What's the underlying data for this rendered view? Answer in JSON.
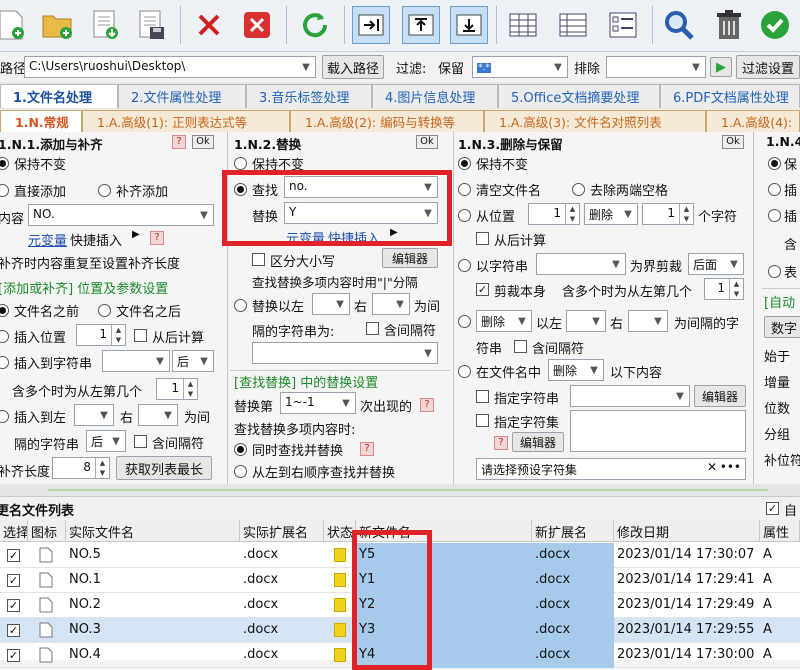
{
  "toolbar": {
    "icons": [
      "add-file-icon",
      "add-folder-icon",
      "import-list-icon",
      "export-list-icon",
      "delete-icon",
      "clear-icon",
      "refresh-icon",
      "move-right-icon",
      "move-up-icon",
      "move-down-icon",
      "columns-icon",
      "rows-icon",
      "checklist-icon",
      "search-icon",
      "trash-icon",
      "check-icon"
    ]
  },
  "pathbar": {
    "label": "路径",
    "path": "C:\\Users\\ruoshui\\Desktop\\",
    "load_button": "载入路径",
    "filter_label": "过滤:",
    "keep_label": "保留",
    "keep_value": "*.*",
    "exclude_label": "排除",
    "exclude_value": "",
    "filter_settings": "过滤设置"
  },
  "tabs1": [
    "1.文件名处理",
    "2.文件属性处理",
    "3.音乐标签处理",
    "4.图片信息处理",
    "5.Office文档摘要处理",
    "6.PDF文档属性处理"
  ],
  "tabs2": [
    "1.N.常规",
    "1.A.高级(1): 正则表达式等",
    "1.A.高级(2): 编码与转换等",
    "1.A.高级(3): 文件名对照列表",
    "1.A.高级(4):"
  ],
  "panel1": {
    "title": "1.N.1.添加与补齐",
    "help": "?",
    "ok": "Ok",
    "keep": "保持不变",
    "direct_add": "直接添加",
    "pad_add": "补齐添加",
    "content_label": "内容",
    "content_value": "NO.",
    "meta_var": "元变量",
    "quick_insert": "快捷插入",
    "hint": "补齐时内容重复至设置补齐长度",
    "section": "[添加或补齐] 位置及参数设置",
    "before_name": "文件名之前",
    "after_name": "文件名之后",
    "insert_pos": "插入位置",
    "insert_pos_value": "1",
    "from_back": "从后计算",
    "insert_to_str": "插入到字符串",
    "insert_dir": "后",
    "multi_which": "含多个时为从左第几个",
    "multi_which_value": "1",
    "insert_left": "插入到左",
    "right": "右",
    "between": "为间",
    "between_str": "隔的字符串",
    "between_dir": "后",
    "include_sep": "含间隔符",
    "pad_len": "补齐长度",
    "pad_len_value": "8",
    "get_max": "获取列表最长"
  },
  "panel2": {
    "title": "1.N.2.替换",
    "ok": "Ok",
    "keep": "保持不变",
    "find_label": "查找",
    "find_value": "no.",
    "replace_label": "替换",
    "replace_value": "Y",
    "meta_var": "元变量",
    "quick_insert": "快捷插入",
    "case": "区分大小写",
    "editor": "编辑器",
    "multi_hint": "查找替换多项内容时用\"|\"分隔",
    "replace_left": "替换以左",
    "right": "右",
    "between": "为间",
    "between_str": "隔的字符串为:",
    "include_sep": "含间隔符",
    "section": "[查找替换] 中的替换设置",
    "replace_nth": "替换第",
    "replace_nth_value": "1~-1",
    "nth_suffix": "次出现的",
    "multi_mode": "查找替换多项内容时:",
    "simultaneous": "同时查找并替换",
    "sequential": "从左到右顺序查找并替换"
  },
  "panel3": {
    "title": "1.N.3.删除与保留",
    "ok": "Ok",
    "keep": "保持不变",
    "clear_name": "清空文件名",
    "trim_spaces": "去除两端空格",
    "from_pos": "从位置",
    "from_pos_value": "1",
    "op": "删除",
    "count_value": "1",
    "chars": "个字符",
    "from_back": "从后计算",
    "by_str": "以字符串",
    "as_boundary": "为界剪裁",
    "cut_dir": "后面",
    "cut_self": "剪裁本身",
    "multi_which": "含多个时为从左第几个",
    "multi_which_value": "1",
    "op2": "删除",
    "left": "以左",
    "right": "右",
    "between": "为间隔的字",
    "str": "符串",
    "include_sep": "含间隔符",
    "in_name": "在文件名中",
    "op3": "删除",
    "following": "以下内容",
    "specify_str": "指定字符串",
    "specify_set": "指定字符集",
    "editor": "编辑器",
    "preset": "请选择预设字符集"
  },
  "panel4": {
    "title": "1.N.4.",
    "keep": "保",
    "insert": "插",
    "insert2": "插",
    "contains": "含",
    "expr": "表",
    "auto": "[自动",
    "number": "数字",
    "start": "始于",
    "inc": "增量",
    "digits": "位数",
    "group": "分组",
    "padchar": "补位符"
  },
  "list": {
    "title": "更名文件列表",
    "auto_label": "自",
    "columns": [
      "选择",
      "图标",
      "实际文件名",
      "实际扩展名",
      "状态",
      "新文件名",
      "新扩展名",
      "修改日期",
      "属性"
    ],
    "rows": [
      {
        "name": "NO.5",
        "ext": ".docx",
        "new": "Y5",
        "newext": ".docx",
        "date": "2023/01/14 17:30:07",
        "attr": "A"
      },
      {
        "name": "NO.1",
        "ext": ".docx",
        "new": "Y1",
        "newext": ".docx",
        "date": "2023/01/14 17:29:41",
        "attr": "A"
      },
      {
        "name": "NO.2",
        "ext": ".docx",
        "new": "Y2",
        "newext": ".docx",
        "date": "2023/01/14 17:29:49",
        "attr": "A"
      },
      {
        "name": "NO.3",
        "ext": ".docx",
        "new": "Y3",
        "newext": ".docx",
        "date": "2023/01/14 17:29:55",
        "attr": "A"
      },
      {
        "name": "NO.4",
        "ext": ".docx",
        "new": "Y4",
        "newext": ".docx",
        "date": "2023/01/14 17:30:00",
        "attr": "A"
      }
    ]
  }
}
